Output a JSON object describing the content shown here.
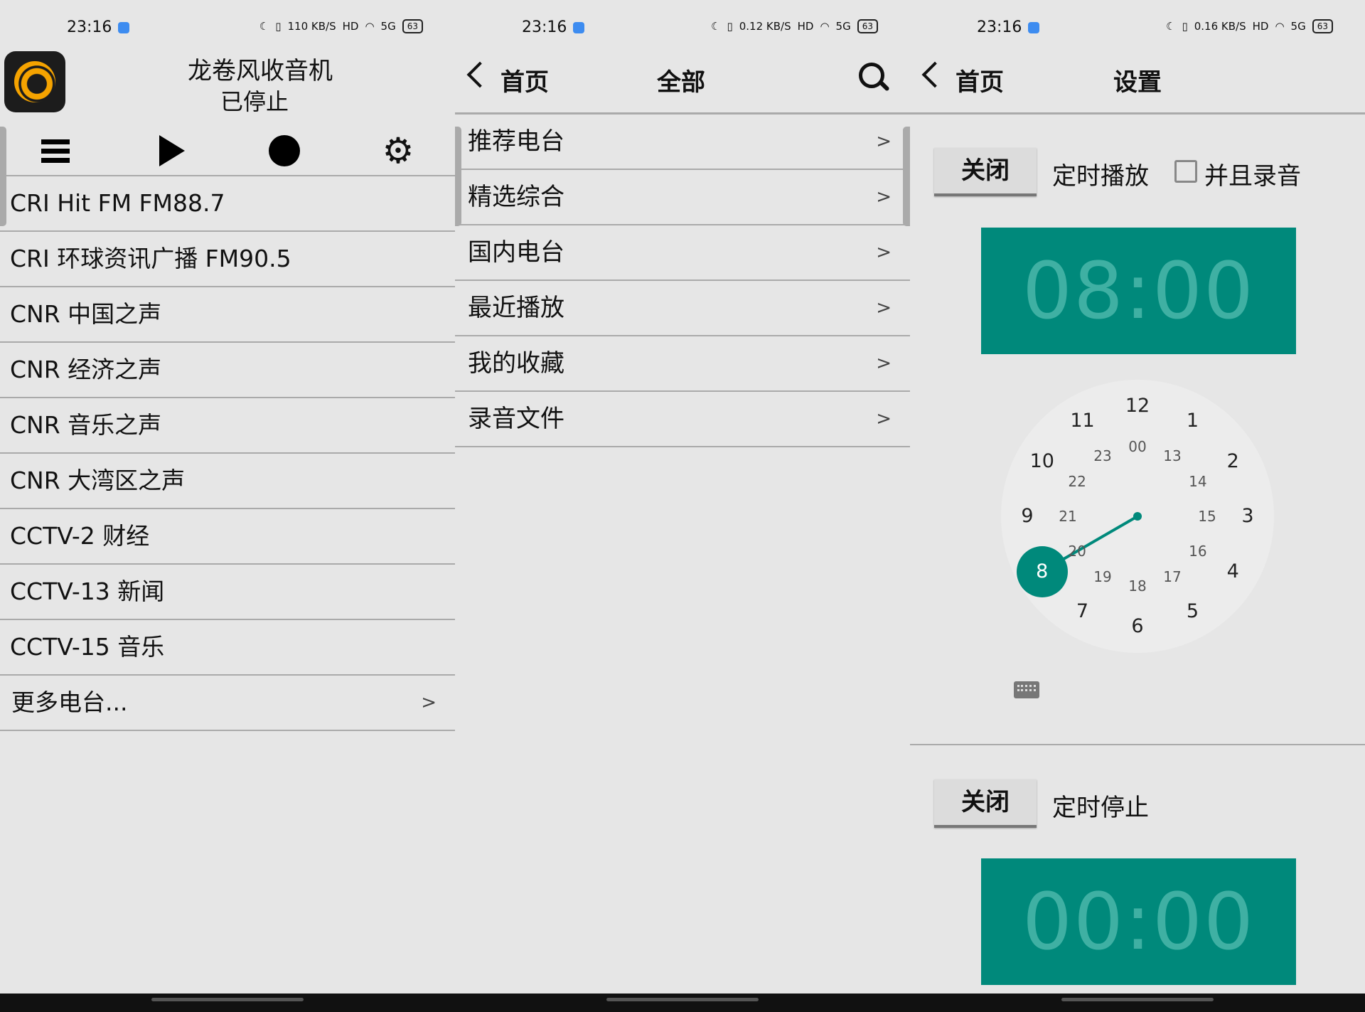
{
  "status": {
    "time": "23:16",
    "speed1": "110 KB/S",
    "speed2": "0.12 KB/S",
    "speed3": "0.16 KB/S",
    "hd": "HD",
    "net": "5G",
    "battery": "63"
  },
  "panel1": {
    "title": "龙卷风收音机",
    "status": "已停止",
    "stations": [
      "CRI Hit FM FM88.7",
      "CRI 环球资讯广播 FM90.5",
      "CNR 中国之声",
      "CNR 经济之声",
      "CNR 音乐之声",
      "CNR 大湾区之声",
      "CCTV-2 财经",
      "CCTV-13 新闻",
      "CCTV-15 音乐"
    ],
    "more": "更多电台...",
    "chevron": ">"
  },
  "panel2": {
    "back": "首页",
    "title": "全部",
    "items": [
      "推荐电台",
      "精选综合",
      "国内电台",
      "最近播放",
      "我的收藏",
      "录音文件"
    ],
    "chevron": ">"
  },
  "panel3": {
    "back": "首页",
    "title": "设置",
    "timer_on": {
      "button": "关闭",
      "label": "定时播放",
      "checkbox_label": "并且录音",
      "time": "08:00"
    },
    "timer_off": {
      "button": "关闭",
      "label": "定时停止",
      "time": "00:00"
    },
    "clock": {
      "outer": [
        "12",
        "1",
        "2",
        "3",
        "4",
        "5",
        "6",
        "7",
        "8",
        "9",
        "10",
        "11"
      ],
      "inner": [
        "00",
        "13",
        "14",
        "15",
        "16",
        "17",
        "18",
        "19",
        "20",
        "21",
        "22",
        "23"
      ],
      "selected": "8"
    }
  },
  "colors": {
    "accent": "#00897b",
    "background": "#e6e6e6"
  }
}
